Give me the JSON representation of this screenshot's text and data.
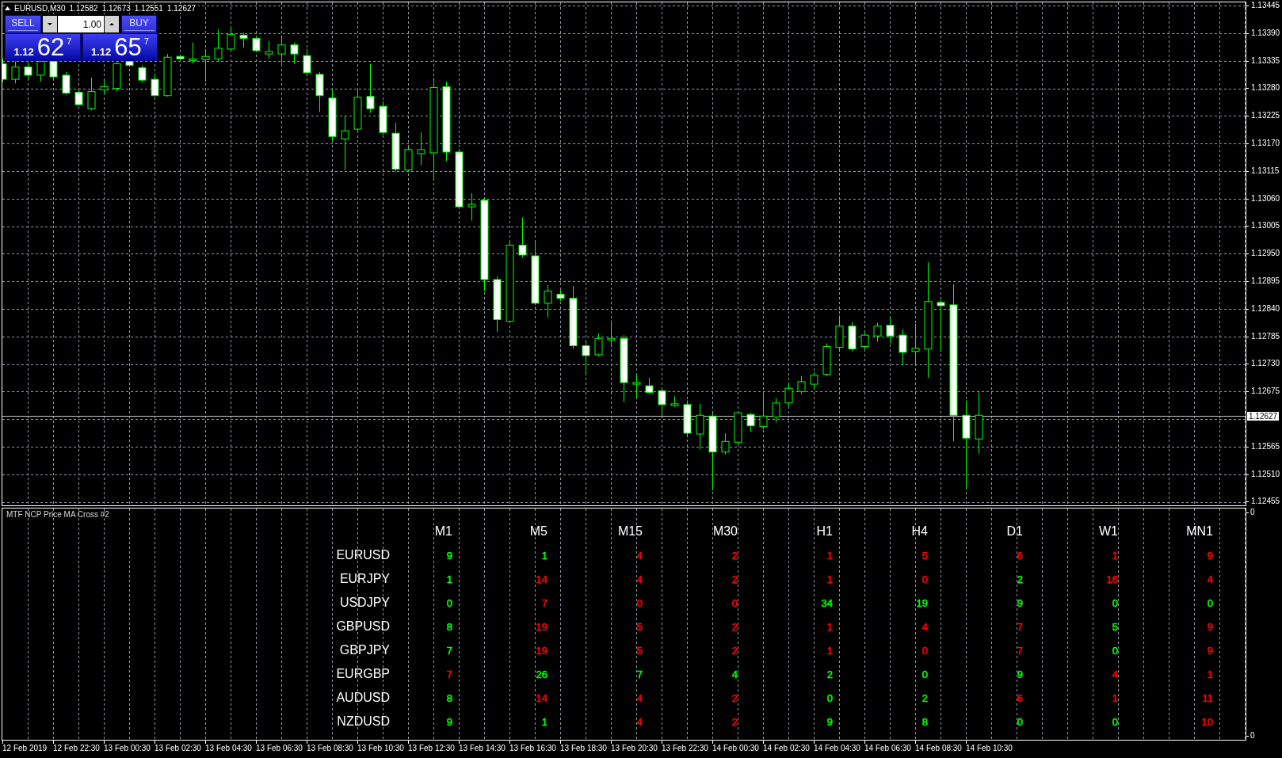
{
  "chart": {
    "title": "EURUSD,M30",
    "quotes": [
      "1.12582",
      "1.12673",
      "1.12551",
      "1.12627"
    ],
    "trade_panel": {
      "sell": {
        "label": "SELL",
        "big_figure": "1.12",
        "pips": "62",
        "fraction": "7"
      },
      "volume": "1.00",
      "buy": {
        "label": "BUY",
        "big_figure": "1.12",
        "pips": "65",
        "fraction": "7"
      }
    }
  },
  "price_axis": {
    "labels_above": [
      "1.13445",
      "1.13390",
      "1.13335",
      "1.13280",
      "1.13225",
      "1.13170",
      "1.13115",
      "1.13060",
      "1.13005",
      "1.12950",
      "1.12895",
      "1.12840",
      "1.12785",
      "1.12730",
      "1.12675"
    ],
    "current_price": "1.12627",
    "labels_below": [
      "1.12565",
      "1.12510",
      "1.12455"
    ]
  },
  "indicator": {
    "title": "MTF NCP Price MA Cross #2",
    "timeframes": [
      "M1",
      "M5",
      "M15",
      "M30",
      "H1",
      "H4",
      "D1",
      "W1",
      "MN1"
    ],
    "rows": [
      {
        "symbol": "EURUSD",
        "cells": [
          {
            "value": "9",
            "color": "#00ff00"
          },
          {
            "value": "1",
            "color": "#00ff00"
          },
          {
            "value": "4",
            "color": "#ff0000"
          },
          {
            "value": "2",
            "color": "#ff0000"
          },
          {
            "value": "1",
            "color": "#ff0000"
          },
          {
            "value": "5",
            "color": "#ff0000"
          },
          {
            "value": "6",
            "color": "#ff0000"
          },
          {
            "value": "1",
            "color": "#ff0000"
          },
          {
            "value": "9",
            "color": "#ff0000"
          }
        ]
      },
      {
        "symbol": "EURJPY",
        "cells": [
          {
            "value": "1",
            "color": "#00ff00"
          },
          {
            "value": "14",
            "color": "#ff0000"
          },
          {
            "value": "4",
            "color": "#ff0000"
          },
          {
            "value": "2",
            "color": "#ff0000"
          },
          {
            "value": "1",
            "color": "#ff0000"
          },
          {
            "value": "0",
            "color": "#ff0000"
          },
          {
            "value": "2",
            "color": "#00ff00"
          },
          {
            "value": "16",
            "color": "#ff0000"
          },
          {
            "value": "4",
            "color": "#ff0000"
          }
        ]
      },
      {
        "symbol": "USDJPY",
        "cells": [
          {
            "value": "0",
            "color": "#00ff00"
          },
          {
            "value": "7",
            "color": "#ff0000"
          },
          {
            "value": "0",
            "color": "#ff0000"
          },
          {
            "value": "0",
            "color": "#ff0000"
          },
          {
            "value": "34",
            "color": "#00ff00"
          },
          {
            "value": "19",
            "color": "#00ff00"
          },
          {
            "value": "9",
            "color": "#00ff00"
          },
          {
            "value": "0",
            "color": "#00ff00"
          },
          {
            "value": "0",
            "color": "#00ff00"
          }
        ]
      },
      {
        "symbol": "GBPUSD",
        "cells": [
          {
            "value": "8",
            "color": "#00ff00"
          },
          {
            "value": "19",
            "color": "#ff0000"
          },
          {
            "value": "5",
            "color": "#ff0000"
          },
          {
            "value": "2",
            "color": "#ff0000"
          },
          {
            "value": "1",
            "color": "#ff0000"
          },
          {
            "value": "4",
            "color": "#ff0000"
          },
          {
            "value": "7",
            "color": "#ff0000"
          },
          {
            "value": "5",
            "color": "#00ff00"
          },
          {
            "value": "9",
            "color": "#ff0000"
          }
        ]
      },
      {
        "symbol": "GBPJPY",
        "cells": [
          {
            "value": "7",
            "color": "#00ff00"
          },
          {
            "value": "19",
            "color": "#ff0000"
          },
          {
            "value": "5",
            "color": "#ff0000"
          },
          {
            "value": "2",
            "color": "#ff0000"
          },
          {
            "value": "1",
            "color": "#ff0000"
          },
          {
            "value": "0",
            "color": "#ff0000"
          },
          {
            "value": "7",
            "color": "#ff0000"
          },
          {
            "value": "0",
            "color": "#00ff00"
          },
          {
            "value": "9",
            "color": "#ff0000"
          }
        ]
      },
      {
        "symbol": "EURGBP",
        "cells": [
          {
            "value": "7",
            "color": "#ff0000"
          },
          {
            "value": "26",
            "color": "#00ff00"
          },
          {
            "value": "7",
            "color": "#00ff00"
          },
          {
            "value": "4",
            "color": "#00ff00"
          },
          {
            "value": "2",
            "color": "#00ff00"
          },
          {
            "value": "0",
            "color": "#00ff00"
          },
          {
            "value": "9",
            "color": "#00ff00"
          },
          {
            "value": "4",
            "color": "#ff0000"
          },
          {
            "value": "1",
            "color": "#ff0000"
          }
        ]
      },
      {
        "symbol": "AUDUSD",
        "cells": [
          {
            "value": "8",
            "color": "#00ff00"
          },
          {
            "value": "14",
            "color": "#ff0000"
          },
          {
            "value": "4",
            "color": "#ff0000"
          },
          {
            "value": "2",
            "color": "#ff0000"
          },
          {
            "value": "0",
            "color": "#00ff00"
          },
          {
            "value": "2",
            "color": "#00ff00"
          },
          {
            "value": "6",
            "color": "#ff0000"
          },
          {
            "value": "1",
            "color": "#ff0000"
          },
          {
            "value": "11",
            "color": "#ff0000"
          }
        ]
      },
      {
        "symbol": "NZDUSD",
        "cells": [
          {
            "value": "9",
            "color": "#00ff00"
          },
          {
            "value": "1",
            "color": "#00ff00"
          },
          {
            "value": "4",
            "color": "#ff0000"
          },
          {
            "value": "2",
            "color": "#ff0000"
          },
          {
            "value": "9",
            "color": "#00ff00"
          },
          {
            "value": "8",
            "color": "#00ff00"
          },
          {
            "value": "0",
            "color": "#00ff00"
          },
          {
            "value": "0",
            "color": "#00ff00"
          },
          {
            "value": "10",
            "color": "#ff0000"
          }
        ]
      }
    ],
    "scale": [
      "0",
      "0"
    ]
  },
  "time_axis": {
    "labels": [
      "12 Feb 2019",
      "12 Feb 22:30",
      "13 Feb 00:30",
      "13 Feb 02:30",
      "13 Feb 04:30",
      "13 Feb 06:30",
      "13 Feb 08:30",
      "13 Feb 10:30",
      "13 Feb 12:30",
      "13 Feb 14:30",
      "13 Feb 16:30",
      "13 Feb 18:30",
      "13 Feb 20:30",
      "13 Feb 22:30",
      "14 Feb 00:30",
      "14 Feb 02:30",
      "14 Feb 04:30",
      "14 Feb 06:30",
      "14 Feb 08:30",
      "14 Feb 10:30"
    ]
  }
}
